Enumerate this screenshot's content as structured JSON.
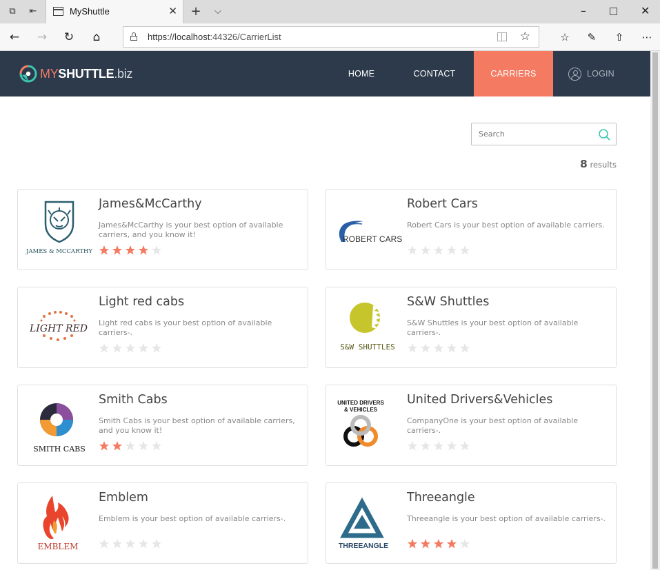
{
  "browser": {
    "tab_title": "MyShuttle",
    "url_host": "https://localhost",
    "url_rest": ":44326/CarrierList"
  },
  "site": {
    "logo": {
      "my": "MY",
      "shuttle": "SHUTTLE",
      "biz": ".biz"
    },
    "nav": {
      "home": "HOME",
      "contact": "CONTACT",
      "carriers": "CARRIERS",
      "login": "LOGIN"
    },
    "colors": {
      "header": "#2c3a4b",
      "accent": "#f47a62"
    }
  },
  "search": {
    "placeholder": "Search"
  },
  "results": {
    "count": "8",
    "label": "results"
  },
  "carriers": [
    {
      "name": "James&McCarthy",
      "description": "James&McCarthy is your best option of available carriers, and you know it!",
      "rating": 4,
      "logo_text": "JAMES & MCCARTHY"
    },
    {
      "name": "Robert Cars",
      "description": "Robert Cars is your best option of available carriers.",
      "rating": 0,
      "logo_text": "ROBERT CARS"
    },
    {
      "name": "Light red cabs",
      "description": "Light red cabs is your best option of available carriers-.",
      "rating": 0,
      "logo_text": "LIGHT RED"
    },
    {
      "name": "S&W Shuttles",
      "description": "S&W Shuttles is your best option of available carriers-.",
      "rating": 0,
      "logo_text": "S&W SHUTTLES"
    },
    {
      "name": "Smith Cabs",
      "description": "Smith Cabs is your best option of available carriers, and you know it!",
      "rating": 2,
      "logo_text": "SMITH CABS"
    },
    {
      "name": "United Drivers&Vehicles",
      "description": "CompanyOne is your best option of available carriers-.",
      "rating": 0,
      "logo_text_1": "UNITED DRIVERS",
      "logo_text_2": "& VEHICLES"
    },
    {
      "name": "Emblem",
      "description": "Emblem is your best option of available carriers-.",
      "rating": 0,
      "logo_text": "EMBLEM"
    },
    {
      "name": "Threeangle",
      "description": "Threeangle is your best option of available carriers-.",
      "rating": 4,
      "logo_text": "THREEANGLE"
    }
  ]
}
